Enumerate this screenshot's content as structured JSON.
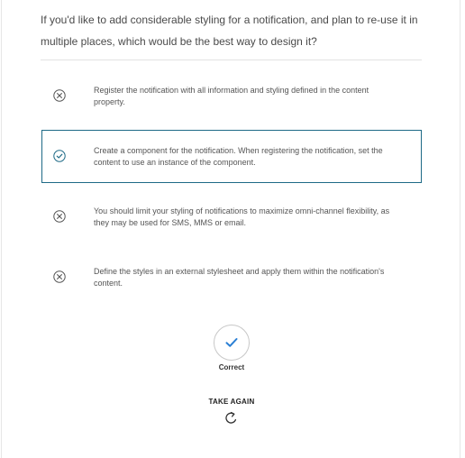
{
  "question": "If you'd like to add considerable styling for a notification, and plan to re-use it in multiple places, which would be the best way to design it?",
  "options": [
    {
      "label": "Register the notification with all information and styling defined in the content property.",
      "state": "incorrect"
    },
    {
      "label": "Create a component for the notification. When registering the notification, set the content to use an instance of the component.",
      "state": "correct-selected"
    },
    {
      "label": "You should limit your styling of notifications to maximize omni-channel flexibility, as they may be used for SMS, MMS or email.",
      "state": "incorrect"
    },
    {
      "label": "Define the styles in an external stylesheet and apply them within the notification's content.",
      "state": "incorrect"
    }
  ],
  "result": {
    "label": "Correct",
    "icon": "checkmark-icon"
  },
  "retake": {
    "label": "TAKE AGAIN",
    "icon": "refresh-icon"
  },
  "colors": {
    "accent": "#1e6a86",
    "correct_check": "#2a7fd4",
    "mark": "#555555"
  }
}
